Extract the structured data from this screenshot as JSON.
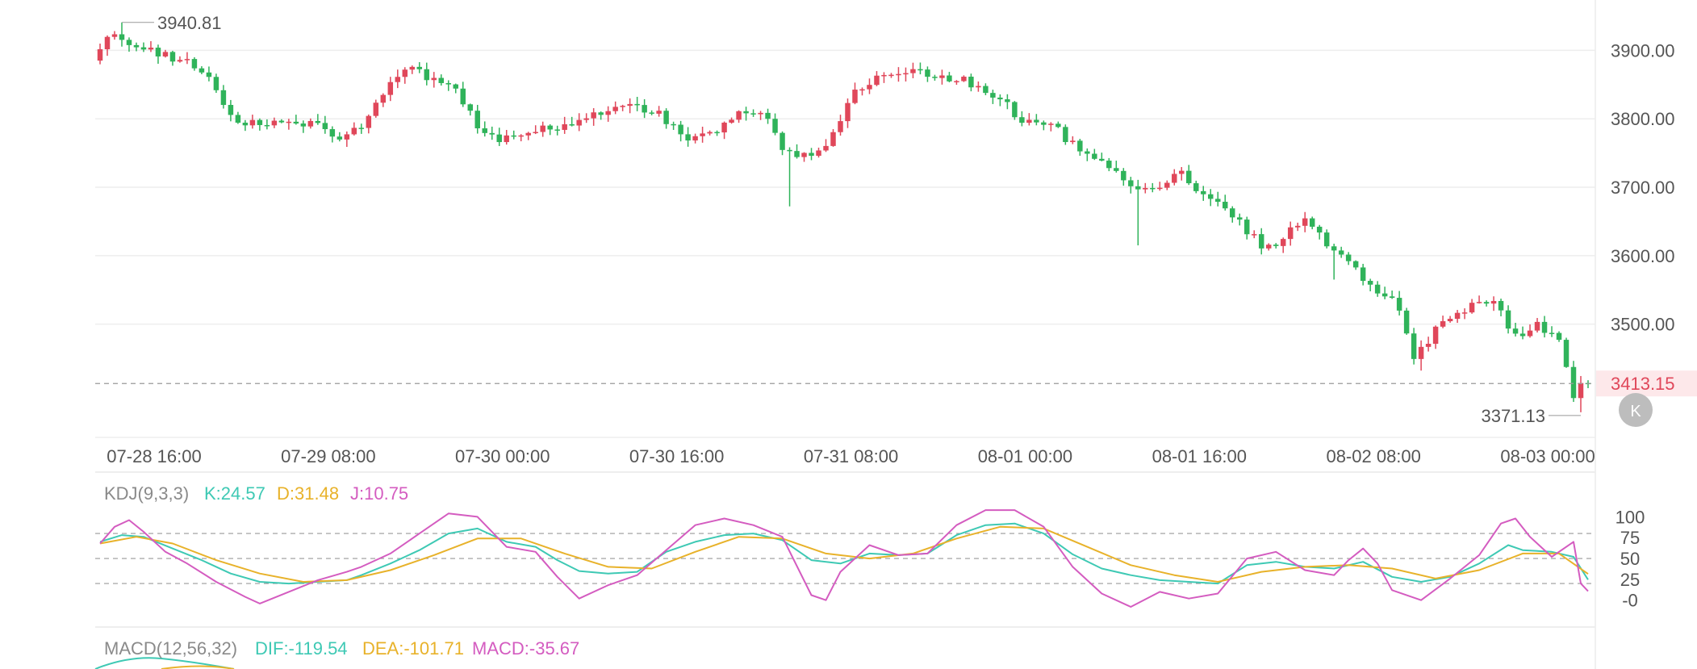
{
  "colors": {
    "up": "#e0475a",
    "down": "#2fb35a",
    "k_line": "#3ec9b4",
    "d_line": "#e8b22a",
    "j_line": "#d45cc0",
    "grid": "#eeeeee",
    "dash": "#9a9a9a",
    "text": "#555555",
    "last_price_bg": "#fde8ea",
    "last_price_text": "#e0475a"
  },
  "chart_data": [
    {
      "type": "candlestick",
      "title": "",
      "ylim": [
        3345,
        3950
      ],
      "y_ticks": [
        {
          "value": 3900,
          "label": "3900.00"
        },
        {
          "value": 3800,
          "label": "3800.00"
        },
        {
          "value": 3700,
          "label": "3700.00"
        },
        {
          "value": 3600,
          "label": "3600.00"
        },
        {
          "value": 3500,
          "label": "3500.00"
        }
      ],
      "x_ticks": [
        {
          "index": 0,
          "label": "07-28 16:00"
        },
        {
          "index": 24,
          "label": "07-29 08:00"
        },
        {
          "index": 48,
          "label": "07-30 00:00"
        },
        {
          "index": 72,
          "label": "07-30 16:00"
        },
        {
          "index": 96,
          "label": "07-31 08:00"
        },
        {
          "index": 120,
          "label": "08-01 00:00"
        },
        {
          "index": 144,
          "label": "08-01 16:00"
        },
        {
          "index": 168,
          "label": "08-02 08:00"
        },
        {
          "index": 192,
          "label": "08-03 00:00"
        }
      ],
      "high_marker": {
        "index": 3,
        "value": 3940.81,
        "label": "3940.81"
      },
      "low_marker": {
        "index": 204,
        "value": 3371.13,
        "label": "3371.13"
      },
      "last_price": {
        "value": 3413.15,
        "label": "3413.15"
      },
      "series_points": [
        {
          "x": 0,
          "y": 3885
        },
        {
          "x": 3,
          "y": 3928
        },
        {
          "x": 5,
          "y": 3905
        },
        {
          "x": 9,
          "y": 3895
        },
        {
          "x": 14,
          "y": 3880
        },
        {
          "x": 17,
          "y": 3845
        },
        {
          "x": 19,
          "y": 3800
        },
        {
          "x": 24,
          "y": 3790
        },
        {
          "x": 30,
          "y": 3795
        },
        {
          "x": 34,
          "y": 3770
        },
        {
          "x": 38,
          "y": 3800
        },
        {
          "x": 41,
          "y": 3860
        },
        {
          "x": 44,
          "y": 3878
        },
        {
          "x": 47,
          "y": 3855
        },
        {
          "x": 50,
          "y": 3845
        },
        {
          "x": 53,
          "y": 3790
        },
        {
          "x": 56,
          "y": 3770
        },
        {
          "x": 60,
          "y": 3780
        },
        {
          "x": 64,
          "y": 3790
        },
        {
          "x": 68,
          "y": 3800
        },
        {
          "x": 71,
          "y": 3815
        },
        {
          "x": 75,
          "y": 3818
        },
        {
          "x": 78,
          "y": 3805
        },
        {
          "x": 82,
          "y": 3770
        },
        {
          "x": 86,
          "y": 3785
        },
        {
          "x": 89,
          "y": 3810
        },
        {
          "x": 93,
          "y": 3800
        },
        {
          "x": 95,
          "y": 3760
        },
        {
          "x": 97,
          "y": 3745
        },
        {
          "x": 100,
          "y": 3755
        },
        {
          "x": 102,
          "y": 3775
        },
        {
          "x": 104,
          "y": 3830
        },
        {
          "x": 108,
          "y": 3860
        },
        {
          "x": 112,
          "y": 3870
        },
        {
          "x": 116,
          "y": 3865
        },
        {
          "x": 120,
          "y": 3855
        },
        {
          "x": 124,
          "y": 3835
        },
        {
          "x": 128,
          "y": 3800
        },
        {
          "x": 132,
          "y": 3790
        },
        {
          "x": 136,
          "y": 3755
        },
        {
          "x": 140,
          "y": 3730
        },
        {
          "x": 144,
          "y": 3700
        },
        {
          "x": 147,
          "y": 3700
        },
        {
          "x": 150,
          "y": 3720
        },
        {
          "x": 154,
          "y": 3680
        },
        {
          "x": 158,
          "y": 3650
        },
        {
          "x": 161,
          "y": 3612
        },
        {
          "x": 164,
          "y": 3625
        },
        {
          "x": 167,
          "y": 3655
        },
        {
          "x": 170,
          "y": 3620
        },
        {
          "x": 174,
          "y": 3580
        },
        {
          "x": 177,
          "y": 3545
        },
        {
          "x": 180,
          "y": 3525
        },
        {
          "x": 182,
          "y": 3455
        },
        {
          "x": 184,
          "y": 3478
        },
        {
          "x": 186,
          "y": 3510
        },
        {
          "x": 190,
          "y": 3525
        },
        {
          "x": 193,
          "y": 3530
        },
        {
          "x": 196,
          "y": 3480
        },
        {
          "x": 199,
          "y": 3505
        },
        {
          "x": 202,
          "y": 3470
        },
        {
          "x": 204,
          "y": 3395
        },
        {
          "x": 205,
          "y": 3413
        }
      ],
      "candle_count": 206
    },
    {
      "type": "line",
      "title": "KDJ(9,3,3)",
      "legend": [
        {
          "name": "K",
          "value": "K:24.57"
        },
        {
          "name": "D",
          "value": "D:31.48"
        },
        {
          "name": "J",
          "value": "J:10.75"
        }
      ],
      "ylim": [
        -8,
        112
      ],
      "y_ticks": [
        "100",
        "75",
        "50",
        "25",
        "-0"
      ],
      "reference_lines": [
        80,
        50,
        20
      ],
      "series": [
        {
          "name": "K",
          "points": [
            {
              "x": 0,
              "y": 70
            },
            {
              "x": 3,
              "y": 78
            },
            {
              "x": 6,
              "y": 76
            },
            {
              "x": 10,
              "y": 62
            },
            {
              "x": 14,
              "y": 48
            },
            {
              "x": 18,
              "y": 32
            },
            {
              "x": 22,
              "y": 22
            },
            {
              "x": 26,
              "y": 20
            },
            {
              "x": 30,
              "y": 22
            },
            {
              "x": 34,
              "y": 24
            },
            {
              "x": 36,
              "y": 30
            },
            {
              "x": 40,
              "y": 44
            },
            {
              "x": 44,
              "y": 60
            },
            {
              "x": 48,
              "y": 80
            },
            {
              "x": 52,
              "y": 86
            },
            {
              "x": 56,
              "y": 70
            },
            {
              "x": 60,
              "y": 64
            },
            {
              "x": 63,
              "y": 48
            },
            {
              "x": 66,
              "y": 35
            },
            {
              "x": 70,
              "y": 32
            },
            {
              "x": 74,
              "y": 34
            },
            {
              "x": 78,
              "y": 58
            },
            {
              "x": 82,
              "y": 70
            },
            {
              "x": 86,
              "y": 78
            },
            {
              "x": 90,
              "y": 80
            },
            {
              "x": 94,
              "y": 72
            },
            {
              "x": 98,
              "y": 48
            },
            {
              "x": 102,
              "y": 44
            },
            {
              "x": 106,
              "y": 56
            },
            {
              "x": 110,
              "y": 54
            },
            {
              "x": 114,
              "y": 56
            },
            {
              "x": 118,
              "y": 78
            },
            {
              "x": 122,
              "y": 90
            },
            {
              "x": 126,
              "y": 92
            },
            {
              "x": 130,
              "y": 80
            },
            {
              "x": 134,
              "y": 55
            },
            {
              "x": 138,
              "y": 38
            },
            {
              "x": 142,
              "y": 30
            },
            {
              "x": 146,
              "y": 24
            },
            {
              "x": 150,
              "y": 22
            },
            {
              "x": 154,
              "y": 20
            },
            {
              "x": 158,
              "y": 42
            },
            {
              "x": 162,
              "y": 46
            },
            {
              "x": 166,
              "y": 40
            },
            {
              "x": 170,
              "y": 38
            },
            {
              "x": 174,
              "y": 46
            },
            {
              "x": 178,
              "y": 28
            },
            {
              "x": 182,
              "y": 22
            },
            {
              "x": 186,
              "y": 28
            },
            {
              "x": 190,
              "y": 44
            },
            {
              "x": 194,
              "y": 66
            },
            {
              "x": 196,
              "y": 60
            },
            {
              "x": 200,
              "y": 58
            },
            {
              "x": 203,
              "y": 52
            },
            {
              "x": 205,
              "y": 24.57
            }
          ]
        },
        {
          "name": "D",
          "points": [
            {
              "x": 0,
              "y": 68
            },
            {
              "x": 5,
              "y": 76
            },
            {
              "x": 10,
              "y": 68
            },
            {
              "x": 16,
              "y": 48
            },
            {
              "x": 22,
              "y": 32
            },
            {
              "x": 28,
              "y": 22
            },
            {
              "x": 34,
              "y": 24
            },
            {
              "x": 40,
              "y": 36
            },
            {
              "x": 46,
              "y": 54
            },
            {
              "x": 52,
              "y": 74
            },
            {
              "x": 58,
              "y": 74
            },
            {
              "x": 64,
              "y": 56
            },
            {
              "x": 70,
              "y": 40
            },
            {
              "x": 76,
              "y": 38
            },
            {
              "x": 82,
              "y": 58
            },
            {
              "x": 88,
              "y": 76
            },
            {
              "x": 94,
              "y": 74
            },
            {
              "x": 100,
              "y": 56
            },
            {
              "x": 106,
              "y": 50
            },
            {
              "x": 112,
              "y": 56
            },
            {
              "x": 118,
              "y": 74
            },
            {
              "x": 124,
              "y": 88
            },
            {
              "x": 130,
              "y": 86
            },
            {
              "x": 136,
              "y": 64
            },
            {
              "x": 142,
              "y": 42
            },
            {
              "x": 148,
              "y": 30
            },
            {
              "x": 154,
              "y": 22
            },
            {
              "x": 160,
              "y": 34
            },
            {
              "x": 166,
              "y": 40
            },
            {
              "x": 172,
              "y": 42
            },
            {
              "x": 178,
              "y": 38
            },
            {
              "x": 184,
              "y": 26
            },
            {
              "x": 190,
              "y": 36
            },
            {
              "x": 196,
              "y": 56
            },
            {
              "x": 201,
              "y": 56
            },
            {
              "x": 205,
              "y": 31.48
            }
          ]
        },
        {
          "name": "J",
          "points": [
            {
              "x": 0,
              "y": 68
            },
            {
              "x": 2,
              "y": 88
            },
            {
              "x": 4,
              "y": 96
            },
            {
              "x": 6,
              "y": 82
            },
            {
              "x": 9,
              "y": 58
            },
            {
              "x": 12,
              "y": 44
            },
            {
              "x": 16,
              "y": 22
            },
            {
              "x": 20,
              "y": 4
            },
            {
              "x": 22,
              "y": -4
            },
            {
              "x": 26,
              "y": 10
            },
            {
              "x": 30,
              "y": 24
            },
            {
              "x": 34,
              "y": 34
            },
            {
              "x": 36,
              "y": 40
            },
            {
              "x": 40,
              "y": 56
            },
            {
              "x": 44,
              "y": 80
            },
            {
              "x": 48,
              "y": 104
            },
            {
              "x": 52,
              "y": 100
            },
            {
              "x": 56,
              "y": 64
            },
            {
              "x": 60,
              "y": 58
            },
            {
              "x": 63,
              "y": 28
            },
            {
              "x": 66,
              "y": 2
            },
            {
              "x": 70,
              "y": 18
            },
            {
              "x": 74,
              "y": 30
            },
            {
              "x": 78,
              "y": 60
            },
            {
              "x": 82,
              "y": 90
            },
            {
              "x": 86,
              "y": 98
            },
            {
              "x": 90,
              "y": 90
            },
            {
              "x": 94,
              "y": 76
            },
            {
              "x": 98,
              "y": 6
            },
            {
              "x": 100,
              "y": 0
            },
            {
              "x": 102,
              "y": 34
            },
            {
              "x": 106,
              "y": 66
            },
            {
              "x": 110,
              "y": 54
            },
            {
              "x": 114,
              "y": 56
            },
            {
              "x": 118,
              "y": 90
            },
            {
              "x": 122,
              "y": 108
            },
            {
              "x": 126,
              "y": 108
            },
            {
              "x": 130,
              "y": 88
            },
            {
              "x": 134,
              "y": 40
            },
            {
              "x": 138,
              "y": 8
            },
            {
              "x": 142,
              "y": -8
            },
            {
              "x": 146,
              "y": 10
            },
            {
              "x": 150,
              "y": 2
            },
            {
              "x": 154,
              "y": 8
            },
            {
              "x": 158,
              "y": 50
            },
            {
              "x": 162,
              "y": 58
            },
            {
              "x": 166,
              "y": 36
            },
            {
              "x": 170,
              "y": 30
            },
            {
              "x": 172,
              "y": 48
            },
            {
              "x": 174,
              "y": 62
            },
            {
              "x": 176,
              "y": 44
            },
            {
              "x": 178,
              "y": 12
            },
            {
              "x": 182,
              "y": 0
            },
            {
              "x": 186,
              "y": 26
            },
            {
              "x": 190,
              "y": 54
            },
            {
              "x": 193,
              "y": 92
            },
            {
              "x": 195,
              "y": 98
            },
            {
              "x": 197,
              "y": 76
            },
            {
              "x": 200,
              "y": 52
            },
            {
              "x": 203,
              "y": 70
            },
            {
              "x": 204,
              "y": 20
            },
            {
              "x": 205,
              "y": 10.75
            }
          ]
        }
      ]
    },
    {
      "type": "bar",
      "title": "MACD(12,56,32)",
      "legend": [
        {
          "name": "DIF",
          "value": "DIF:-119.54"
        },
        {
          "name": "DEA",
          "value": "DEA:-101.71"
        },
        {
          "name": "MACD",
          "value": "MACD:-35.67"
        }
      ]
    }
  ],
  "side_button": {
    "label": "K"
  }
}
